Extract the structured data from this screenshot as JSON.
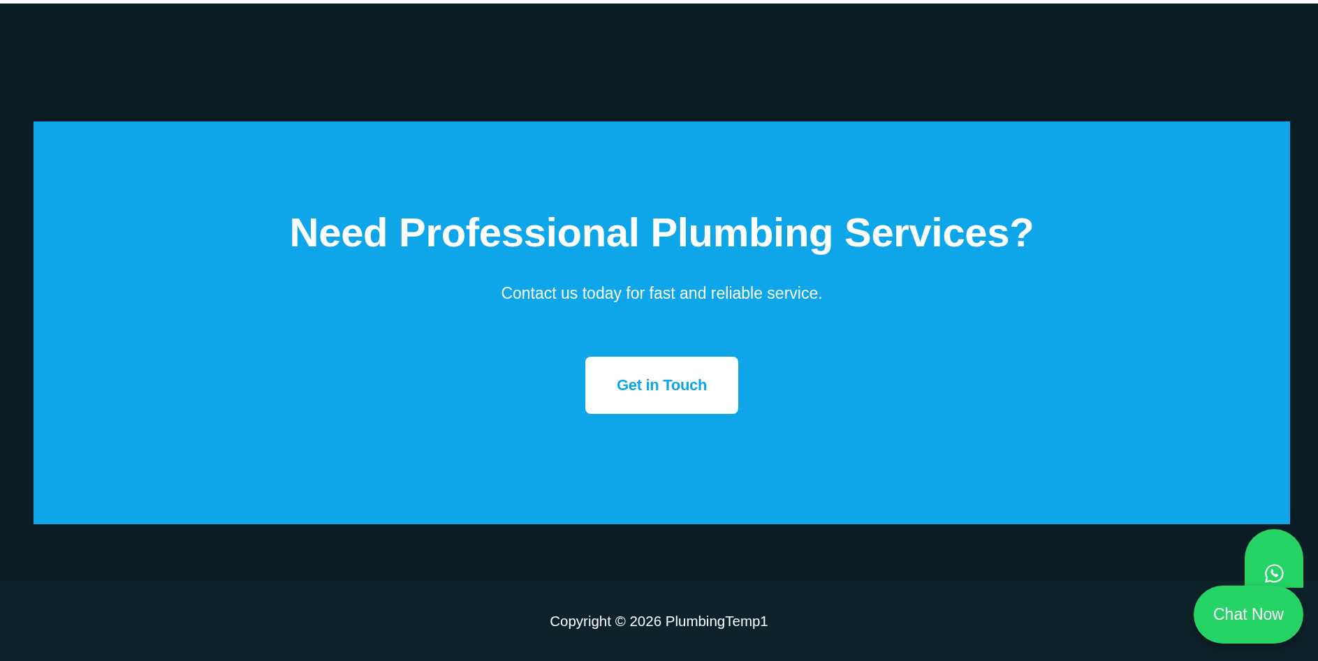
{
  "cta": {
    "heading": "Need Professional Plumbing Services?",
    "subtitle": "Contact us today for fast and reliable service.",
    "button": "Get in Touch"
  },
  "footer": {
    "copyright": "Copyright © 2026 PlumbingTemp1"
  },
  "chat_widget": {
    "button": "Chat Now"
  }
}
